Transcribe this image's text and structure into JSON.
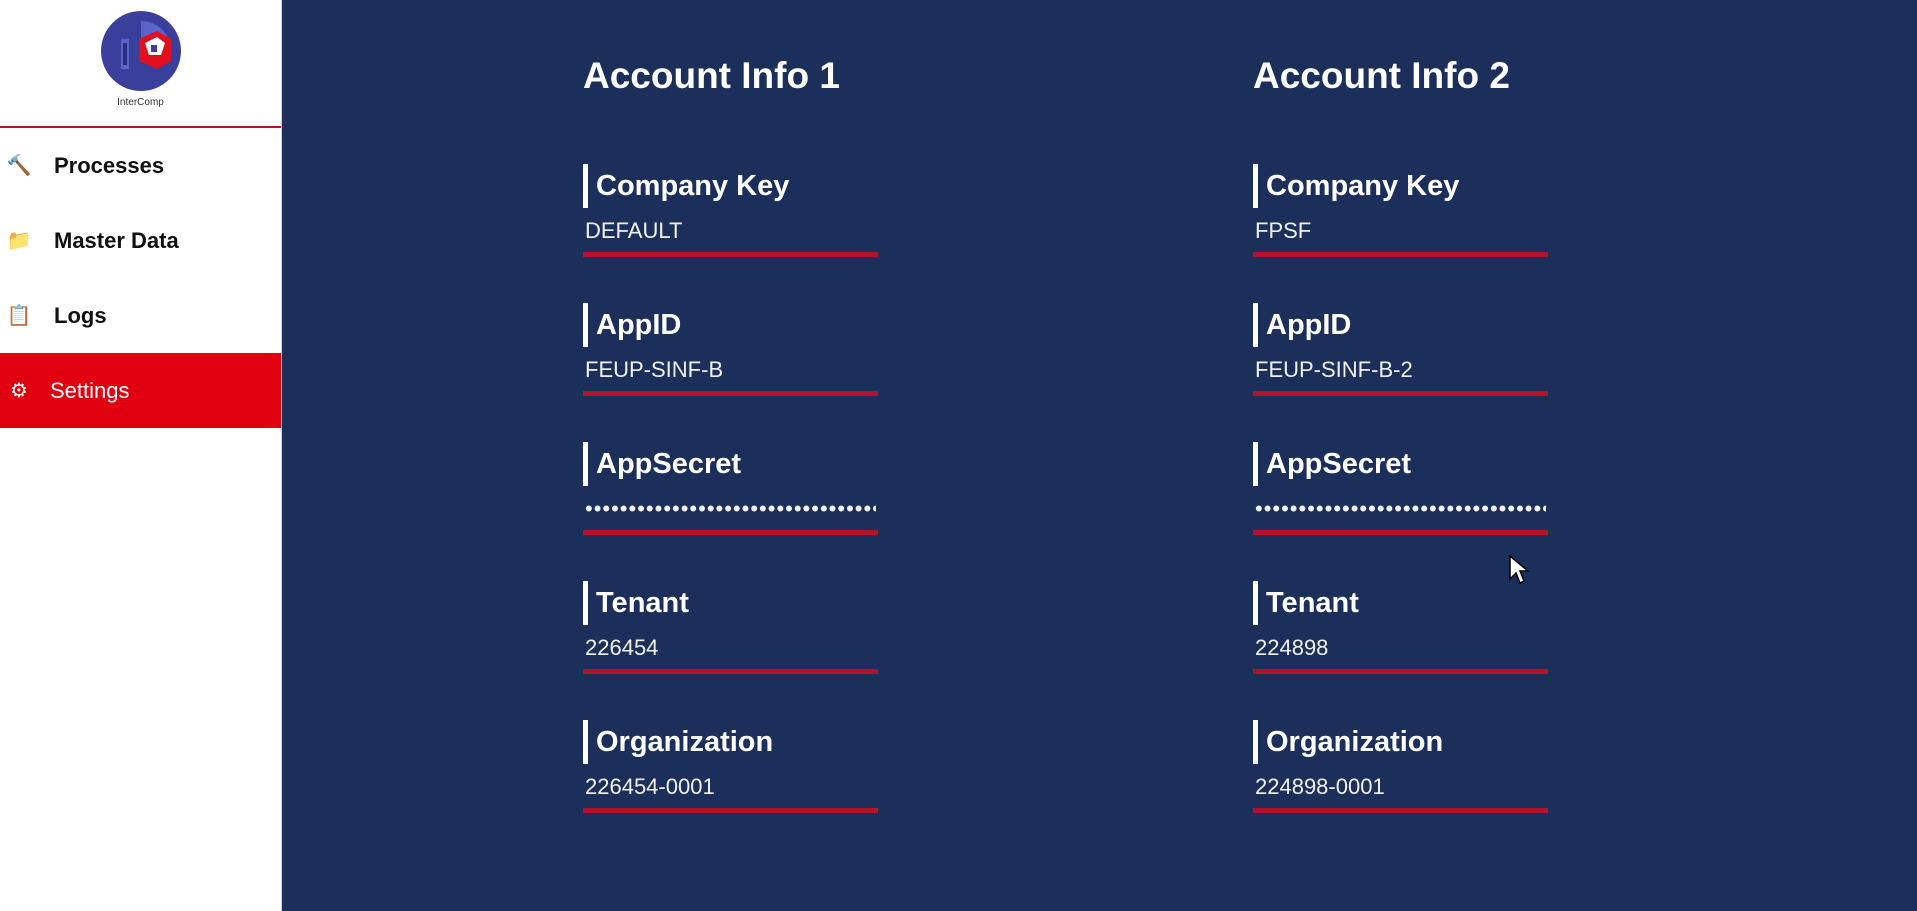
{
  "app": {
    "logo_text": "InterComp"
  },
  "sidebar": {
    "items": [
      {
        "label": "Processes",
        "icon": "hammer-icon",
        "glyph": "🔨"
      },
      {
        "label": "Master Data",
        "icon": "folder-icon",
        "glyph": "📁"
      },
      {
        "label": "Logs",
        "icon": "clipboard-icon",
        "glyph": "📋"
      },
      {
        "label": "Settings",
        "icon": "gear-icon",
        "glyph": "⚙"
      }
    ],
    "active": "Settings"
  },
  "accounts": [
    {
      "title": "Account Info 1",
      "fields": {
        "company_key": {
          "label": "Company Key",
          "value": "DEFAULT"
        },
        "app_id": {
          "label": "AppID",
          "value": "FEUP-SINF-B"
        },
        "app_secret": {
          "label": "AppSecret",
          "value": "••••••••••••••••••••••••••••••••••••••••"
        },
        "tenant": {
          "label": "Tenant",
          "value": "226454"
        },
        "organization": {
          "label": "Organization",
          "value": "226454-0001"
        }
      }
    },
    {
      "title": "Account Info 2",
      "fields": {
        "company_key": {
          "label": "Company Key",
          "value": "FPSF"
        },
        "app_id": {
          "label": "AppID",
          "value": "FEUP-SINF-B-2"
        },
        "app_secret": {
          "label": "AppSecret",
          "value": "••••••••••••••••••••••••••••••••••••••••"
        },
        "tenant": {
          "label": "Tenant",
          "value": "224898"
        },
        "organization": {
          "label": "Organization",
          "value": "224898-0001"
        }
      }
    }
  ],
  "colors": {
    "background": "#1b2f5a",
    "accent": "#e0000f",
    "underline": "#b3122a"
  }
}
